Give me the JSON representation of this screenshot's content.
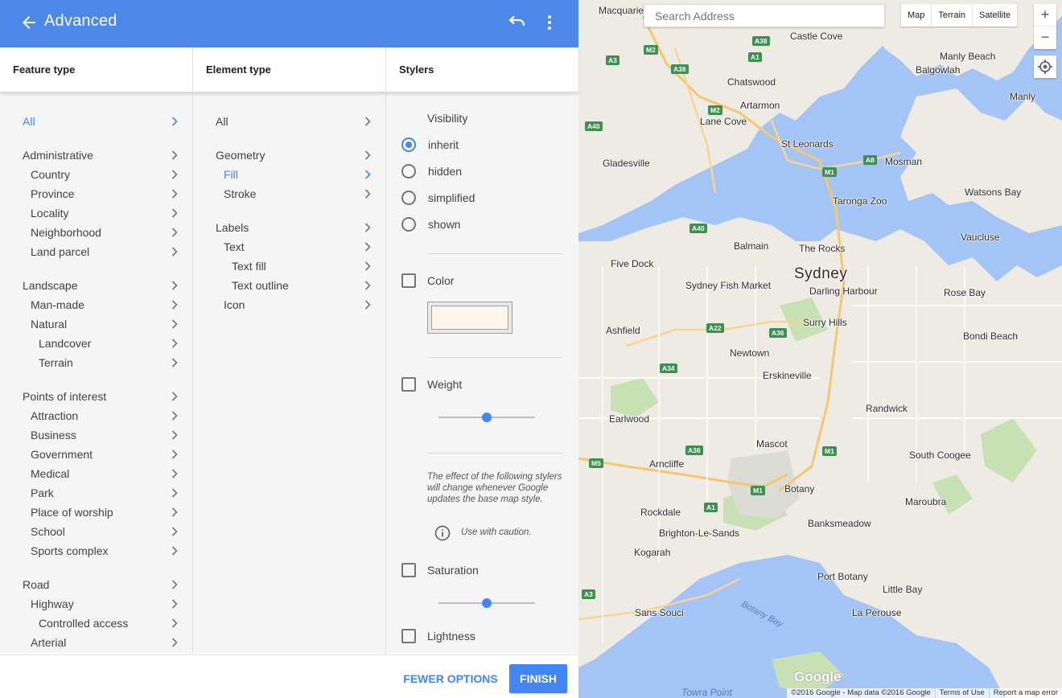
{
  "topbar": {
    "title": "Advanced",
    "color": "#4d87e8"
  },
  "columns": {
    "feature": "Feature type",
    "element": "Element type",
    "stylers": "Stylers"
  },
  "feature_types": [
    {
      "label": "All",
      "level": 0,
      "active": true
    },
    {
      "label": "Administrative",
      "level": 0
    },
    {
      "label": "Country",
      "level": 1
    },
    {
      "label": "Province",
      "level": 1
    },
    {
      "label": "Locality",
      "level": 1
    },
    {
      "label": "Neighborhood",
      "level": 1
    },
    {
      "label": "Land parcel",
      "level": 1
    },
    {
      "label": "Landscape",
      "level": 0
    },
    {
      "label": "Man-made",
      "level": 1
    },
    {
      "label": "Natural",
      "level": 1
    },
    {
      "label": "Landcover",
      "level": 2
    },
    {
      "label": "Terrain",
      "level": 2
    },
    {
      "label": "Points of interest",
      "level": 0
    },
    {
      "label": "Attraction",
      "level": 1
    },
    {
      "label": "Business",
      "level": 1
    },
    {
      "label": "Government",
      "level": 1
    },
    {
      "label": "Medical",
      "level": 1
    },
    {
      "label": "Park",
      "level": 1
    },
    {
      "label": "Place of worship",
      "level": 1
    },
    {
      "label": "School",
      "level": 1
    },
    {
      "label": "Sports complex",
      "level": 1
    },
    {
      "label": "Road",
      "level": 0
    },
    {
      "label": "Highway",
      "level": 1
    },
    {
      "label": "Controlled access",
      "level": 2
    },
    {
      "label": "Arterial",
      "level": 1
    }
  ],
  "element_types": [
    {
      "label": "All",
      "level": 0
    },
    {
      "label": "Geometry",
      "level": 0
    },
    {
      "label": "Fill",
      "level": 1,
      "active": true
    },
    {
      "label": "Stroke",
      "level": 1
    },
    {
      "label": "Labels",
      "level": 0
    },
    {
      "label": "Text",
      "level": 1
    },
    {
      "label": "Text fill",
      "level": 2
    },
    {
      "label": "Text outline",
      "level": 2
    },
    {
      "label": "Icon",
      "level": 1
    }
  ],
  "stylers": {
    "visibility": {
      "label": "Visibility",
      "options": [
        "inherit",
        "hidden",
        "simplified",
        "shown"
      ],
      "selected": "inherit"
    },
    "color": {
      "label": "Color",
      "checked": false,
      "swatch": "#fdf5ea"
    },
    "weight": {
      "label": "Weight",
      "checked": false,
      "slider_fraction": 0.5
    },
    "caution": "The effect of the following stylers will change whenever Google updates the base map style.",
    "caution_label": "Use with caution.",
    "saturation": {
      "label": "Saturation",
      "checked": false,
      "slider_fraction": 0.5
    },
    "lightness": {
      "label": "Lightness",
      "checked": false
    }
  },
  "footer": {
    "fewer_label": "FEWER OPTIONS",
    "finish_label": "FINISH",
    "accent": "#4285f4"
  },
  "map": {
    "search_placeholder": "Search Address",
    "map_types": [
      "Map",
      "Terrain",
      "Satellite"
    ],
    "zoom_in": "+",
    "zoom_out": "−",
    "logo": "Google",
    "attribution": [
      "©2016 Google - Map data ©2016 Google",
      "Terms of Use",
      "Report a map error"
    ],
    "places": [
      {
        "name": "Macquarie Park",
        "size": "normal"
      },
      {
        "name": "Castle Cove",
        "size": "normal"
      },
      {
        "name": "Manly Beach",
        "size": "normal"
      },
      {
        "name": "Balgowlah",
        "size": "normal"
      },
      {
        "name": "Chatswood",
        "size": "normal"
      },
      {
        "name": "Manly",
        "size": "normal"
      },
      {
        "name": "Artarmon",
        "size": "normal"
      },
      {
        "name": "Lane Cove",
        "size": "normal"
      },
      {
        "name": "St Leonards",
        "size": "normal"
      },
      {
        "name": "Gladesville",
        "size": "normal"
      },
      {
        "name": "Mosman",
        "size": "normal"
      },
      {
        "name": "Taronga Zoo",
        "size": "normal"
      },
      {
        "name": "Watsons Bay",
        "size": "normal"
      },
      {
        "name": "Vaucluse",
        "size": "normal"
      },
      {
        "name": "Balmain",
        "size": "normal"
      },
      {
        "name": "The Rocks",
        "size": "normal"
      },
      {
        "name": "Five Dock",
        "size": "normal"
      },
      {
        "name": "Sydney",
        "size": "big"
      },
      {
        "name": "Sydney Fish Market",
        "size": "normal"
      },
      {
        "name": "Darling Harbour",
        "size": "normal"
      },
      {
        "name": "Rose Bay",
        "size": "normal"
      },
      {
        "name": "Ashfield",
        "size": "normal"
      },
      {
        "name": "Surry Hills",
        "size": "normal"
      },
      {
        "name": "Bondi Beach",
        "size": "normal"
      },
      {
        "name": "Newtown",
        "size": "normal"
      },
      {
        "name": "Erskineville",
        "size": "normal"
      },
      {
        "name": "Randwick",
        "size": "normal"
      },
      {
        "name": "Earlwood",
        "size": "normal"
      },
      {
        "name": "Mascot",
        "size": "normal"
      },
      {
        "name": "Arncliffe",
        "size": "normal"
      },
      {
        "name": "South Coogee",
        "size": "normal"
      },
      {
        "name": "Botany",
        "size": "normal"
      },
      {
        "name": "Rockdale",
        "size": "normal"
      },
      {
        "name": "Maroubra",
        "size": "normal"
      },
      {
        "name": "Brighton-Le-Sands",
        "size": "normal"
      },
      {
        "name": "Banksmeadow",
        "size": "normal"
      },
      {
        "name": "Kogarah",
        "size": "normal"
      },
      {
        "name": "Port Botany",
        "size": "normal"
      },
      {
        "name": "Little Bay",
        "size": "normal"
      },
      {
        "name": "Sans Souci",
        "size": "normal"
      },
      {
        "name": "La Perouse",
        "size": "normal"
      },
      {
        "name": "Botany Bay",
        "size": "water"
      },
      {
        "name": "Towra Point",
        "size": "water"
      }
    ],
    "shields": [
      "M2",
      "A38",
      "A3",
      "A1",
      "A38",
      "M2",
      "A40",
      "M1",
      "A8",
      "A40",
      "A22",
      "A36",
      "A34",
      "A36",
      "M5",
      "M1",
      "M1",
      "A1",
      "A3"
    ]
  }
}
